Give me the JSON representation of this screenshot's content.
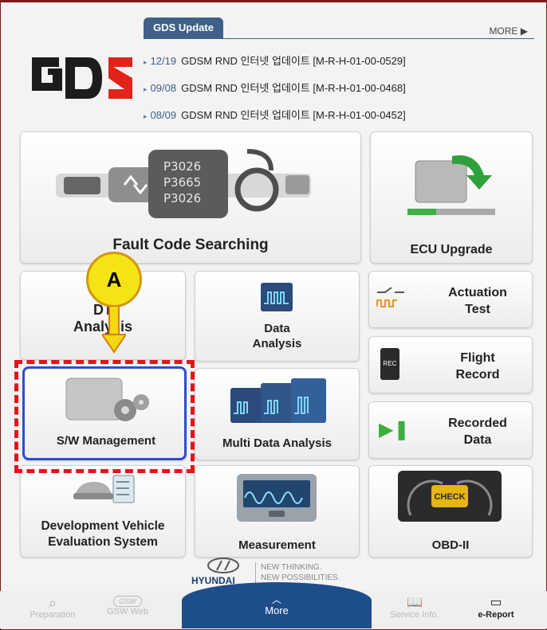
{
  "header": {
    "logo_text": "GDS",
    "tab_title": "GDS Update",
    "more_label": "MORE ▶",
    "news": [
      {
        "date": "12/19",
        "text": "GDSM RND 인터넷 업데이트 [M-R-H-01-00-0529]"
      },
      {
        "date": "09/08",
        "text": "GDSM RND 인터넷 업데이트 [M-R-H-01-00-0468]"
      },
      {
        "date": "08/09",
        "text": "GDSM RND 인터넷 업데이트 [M-R-H-01-00-0452]"
      }
    ]
  },
  "tiles": {
    "fault_code": {
      "label": "Fault Code Searching",
      "codes": [
        "P3026",
        "P3665",
        "P3026"
      ]
    },
    "ecu_upgrade": {
      "label": "ECU Upgrade"
    },
    "dtc_analysis": {
      "label_line1": "DT",
      "label_line2": "Analysis"
    },
    "data_analysis": {
      "label_line1": "Data",
      "label_line2": "Analysis"
    },
    "actuation_test": {
      "label_line1": "Actuation",
      "label_line2": "Test"
    },
    "flight_record": {
      "label_line1": "Flight",
      "label_line2": "Record",
      "icon_text": "REC"
    },
    "sw_management": {
      "label": "S/W Management"
    },
    "multi_data": {
      "label": "Multi Data Analysis"
    },
    "recorded_data": {
      "label_line1": "Recorded",
      "label_line2": "Data"
    },
    "dev_vehicle": {
      "label_line1": "Development Vehicle",
      "label_line2": "Evaluation System"
    },
    "measurement": {
      "label": "Measurement"
    },
    "obd": {
      "label": "OBD-II",
      "icon_text": "CHECK"
    }
  },
  "callout": {
    "label": "A"
  },
  "footer": {
    "brand": "HYUNDAI",
    "slogan_line1": "NEW THINKING.",
    "slogan_line2": "NEW POSSIBILITIES.",
    "nav": {
      "preparation": "Preparation",
      "gsw_web": "GSW Web",
      "gsw_icon": "GSW",
      "more": "More",
      "service_info": "Service Info.",
      "e_report": "e-Report"
    }
  },
  "colors": {
    "accent": "#3f6188",
    "highlight": "#e8121b",
    "selected": "#2c4ecf",
    "callout": "#f5e414"
  }
}
